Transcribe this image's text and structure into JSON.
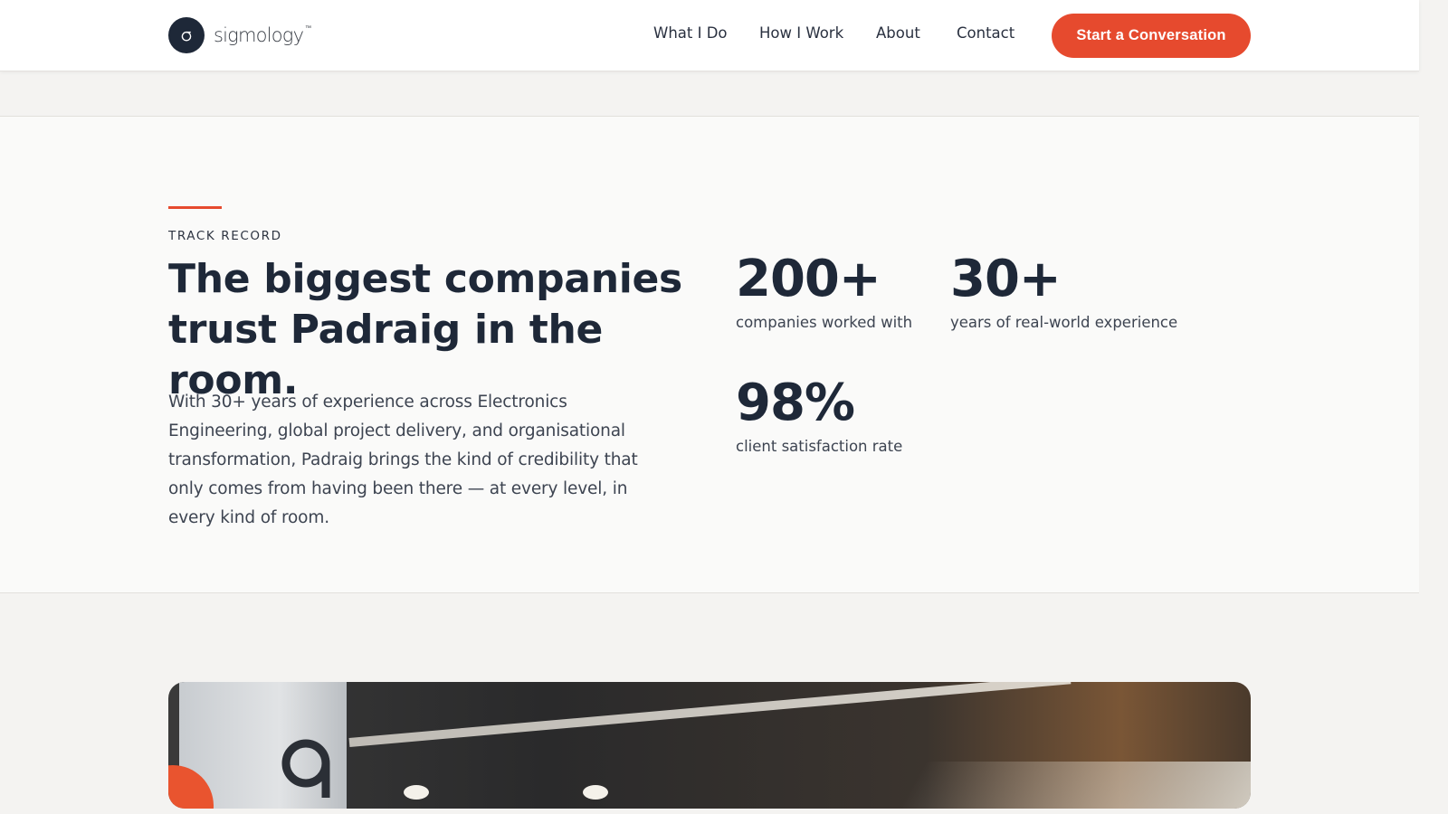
{
  "header": {
    "logo_text": "sigmology",
    "logo_tm": "™",
    "nav": [
      "What I Do",
      "How I Work",
      "About",
      "Contact"
    ],
    "cta_label": "Start a Conversation"
  },
  "track_record": {
    "eyebrow": "TRACK RECORD",
    "headline_line1": "The biggest companies",
    "headline_line2": "trust Padraig in the room.",
    "body": "With 30+ years of experience across Electronics Engineering, global project delivery, and organisational transformation, Padraig brings the kind of credibility that only comes from having been there — at every level, in every kind of room.",
    "stats": [
      {
        "value": "200+",
        "label": "companies worked with"
      },
      {
        "value": "30+",
        "label": "years of real-world experience"
      },
      {
        "value": "98%",
        "label": "client satisfaction rate"
      }
    ]
  },
  "colors": {
    "accent": "#e64a2e",
    "navy": "#1e2838",
    "background": "#fafaf9"
  }
}
